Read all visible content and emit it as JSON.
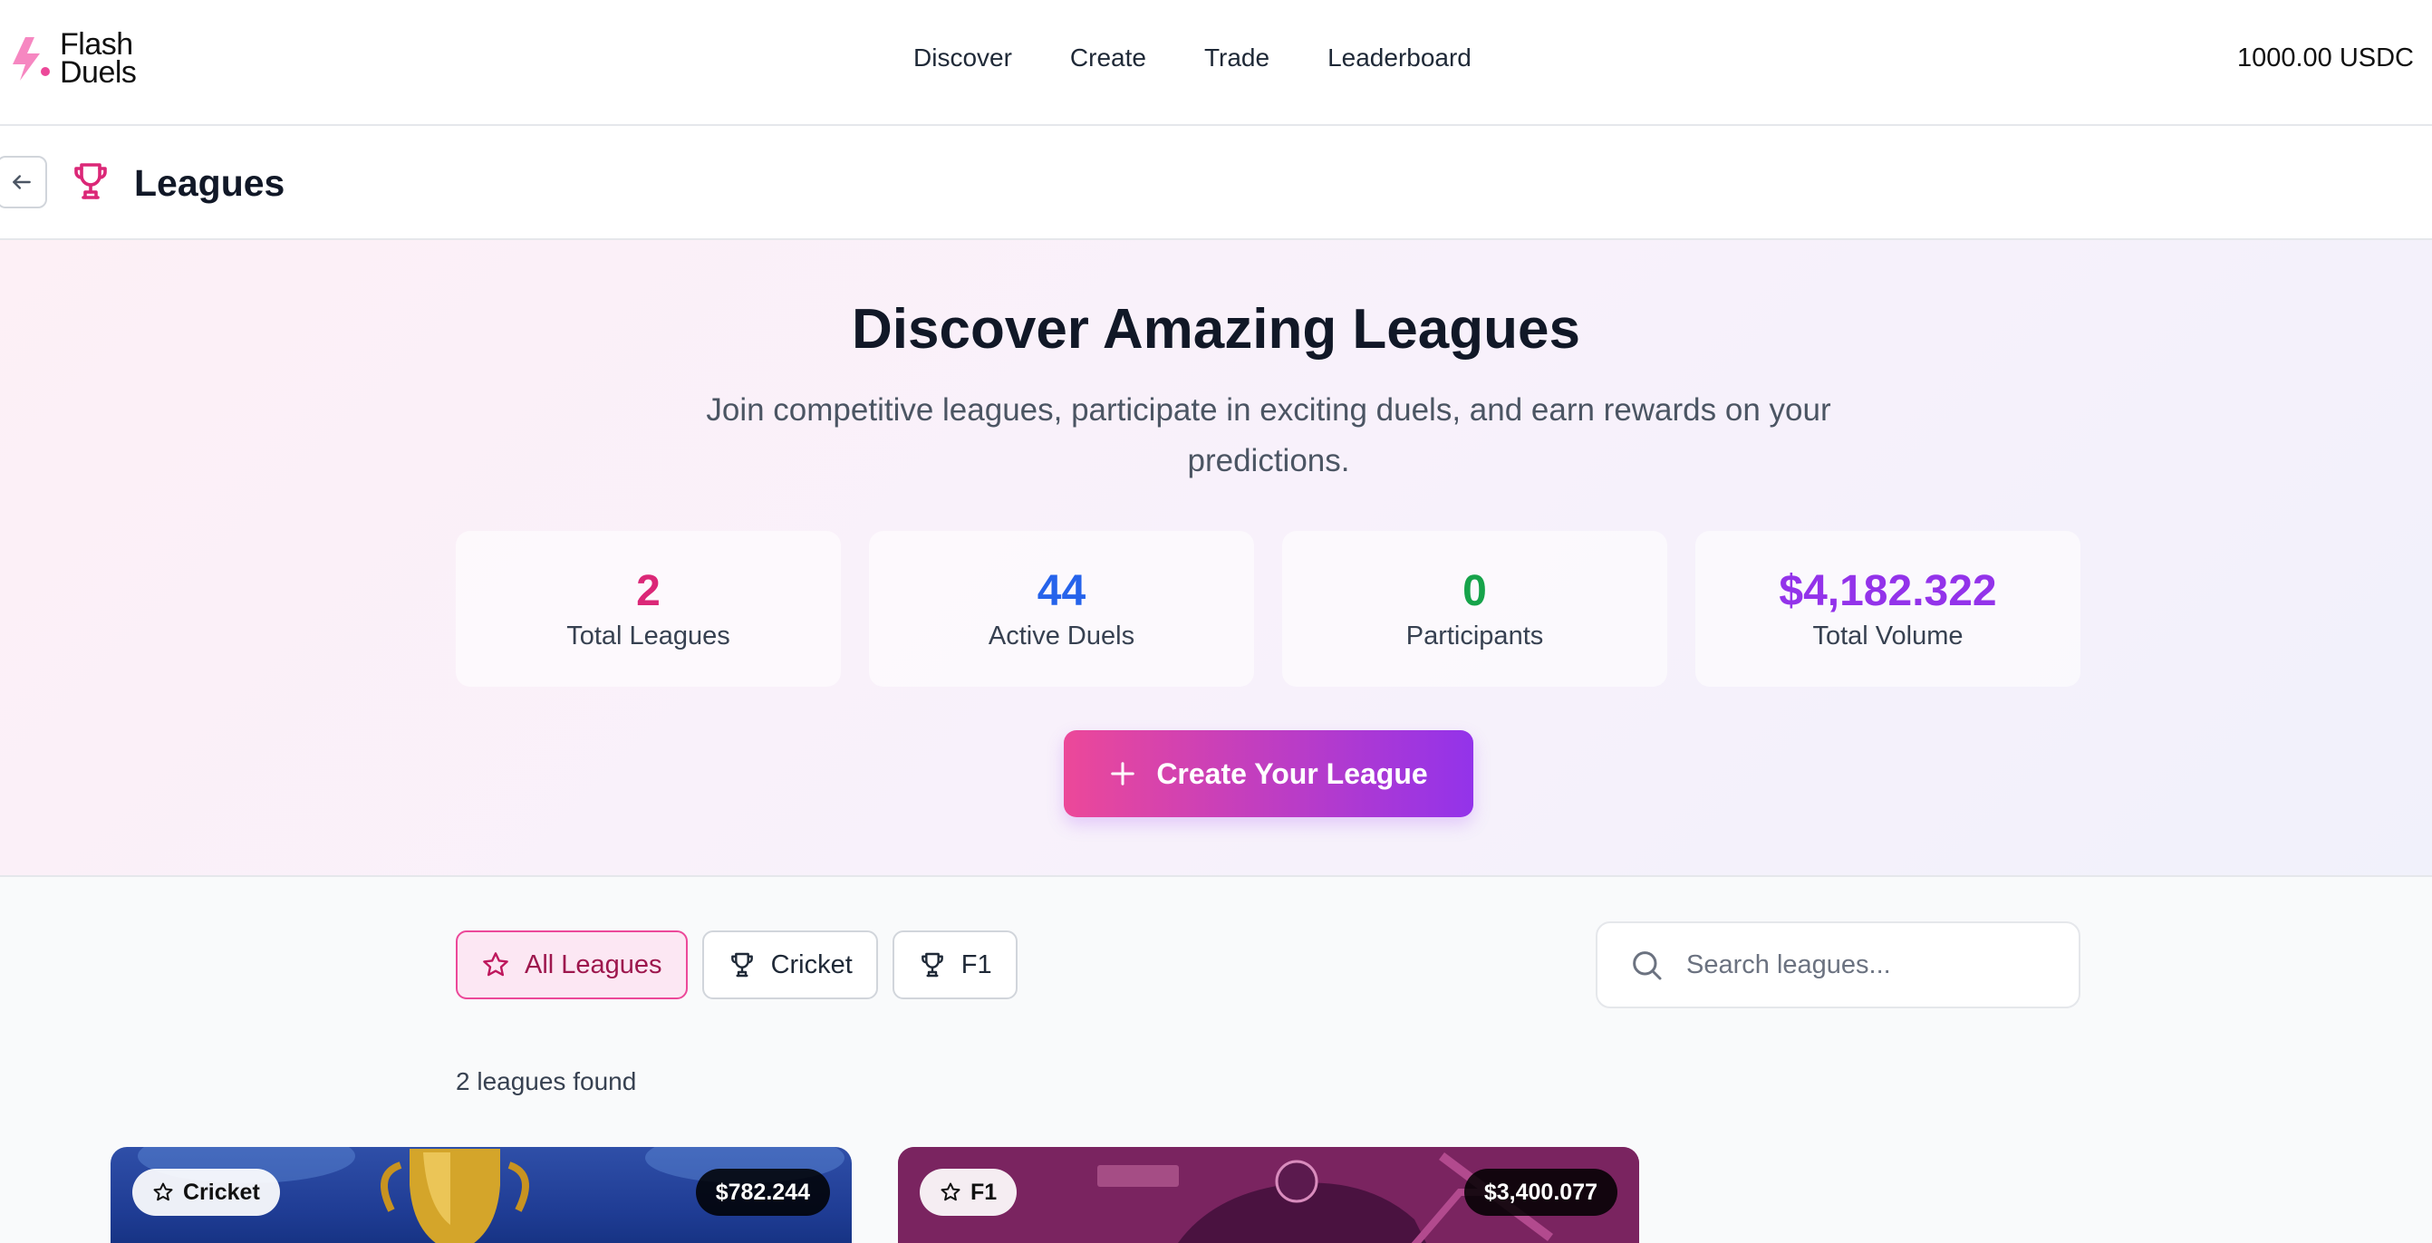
{
  "app": {
    "logo_line1": "Flash",
    "logo_line2": "Duels"
  },
  "nav": {
    "items": [
      {
        "label": "Discover"
      },
      {
        "label": "Create"
      },
      {
        "label": "Trade"
      },
      {
        "label": "Leaderboard"
      }
    ],
    "balance": "1000.00 USDC"
  },
  "header": {
    "title": "Leagues",
    "back_icon": "arrow-left-icon",
    "title_icon": "trophy-icon"
  },
  "hero": {
    "title": "Discover Amazing Leagues",
    "subtitle": "Join competitive leagues, participate in exciting duels, and earn rewards on your predictions.",
    "stats": [
      {
        "value": "2",
        "label": "Total Leagues",
        "color": "#db2777"
      },
      {
        "value": "44",
        "label": "Active Duels",
        "color": "#2563eb"
      },
      {
        "value": "0",
        "label": "Participants",
        "color": "#16a34a"
      },
      {
        "value": "$4,182.322",
        "label": "Total Volume",
        "color": "#9333ea"
      }
    ],
    "cta_label": "Create Your League"
  },
  "filters": {
    "tabs": [
      {
        "label": "All Leagues",
        "icon": "star-icon",
        "active": true
      },
      {
        "label": "Cricket",
        "icon": "trophy-icon",
        "active": false
      },
      {
        "label": "F1",
        "icon": "trophy-icon",
        "active": false
      }
    ],
    "search_placeholder": "Search leagues...",
    "results_count": "2 leagues found"
  },
  "leagues": [
    {
      "category": "Cricket",
      "volume": "$782.244"
    },
    {
      "category": "F1",
      "volume": "$3,400.077"
    }
  ],
  "colors": {
    "accent_pink": "#ec4899",
    "accent_purple": "#9333ea"
  }
}
